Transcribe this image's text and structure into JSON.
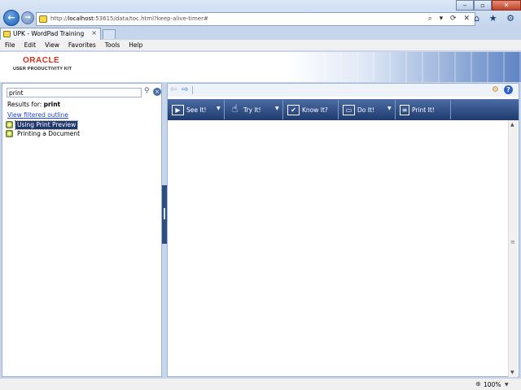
{
  "browser": {
    "url_prefix": "http://",
    "url_host": "localhost",
    "url_rest": ":53615/data/toc.html?keep-alive-timer#",
    "address_tools": "⌕ ▾ ⟳ ✕",
    "window_controls": {
      "minimize": "‒",
      "maximize": "▫",
      "close": "✕"
    },
    "right_icons": "⌂ ★ ⚙",
    "tab": {
      "label": "UPK - WordPad Training",
      "close": "×"
    },
    "menu": [
      "File",
      "Edit",
      "View",
      "Favorites",
      "Tools",
      "Help"
    ]
  },
  "banner": {
    "logo_line1": "ORACLE",
    "logo_line2": "USER PRODUCTIVITY KIT"
  },
  "search": {
    "query": "print",
    "results_label": "Results for:",
    "results_term": "print",
    "filter_link": "View filtered outline",
    "results": [
      {
        "label": "Using Print Preview",
        "selected": true
      },
      {
        "label": "Printing a Document",
        "selected": false
      }
    ]
  },
  "topic": {
    "modes": [
      {
        "label": "See It!",
        "icon": "play-icon",
        "dropdown": true
      },
      {
        "label": "Try It!",
        "icon": "hand-pointer-icon",
        "dropdown": true
      },
      {
        "label": "Know It?",
        "icon": "checklist-icon",
        "dropdown": false
      },
      {
        "label": "Do It!",
        "icon": "window-icon",
        "dropdown": true
      },
      {
        "label": "Print It!",
        "icon": "document-icon",
        "dropdown": false
      }
    ]
  },
  "status": {
    "zoom": "100%"
  }
}
